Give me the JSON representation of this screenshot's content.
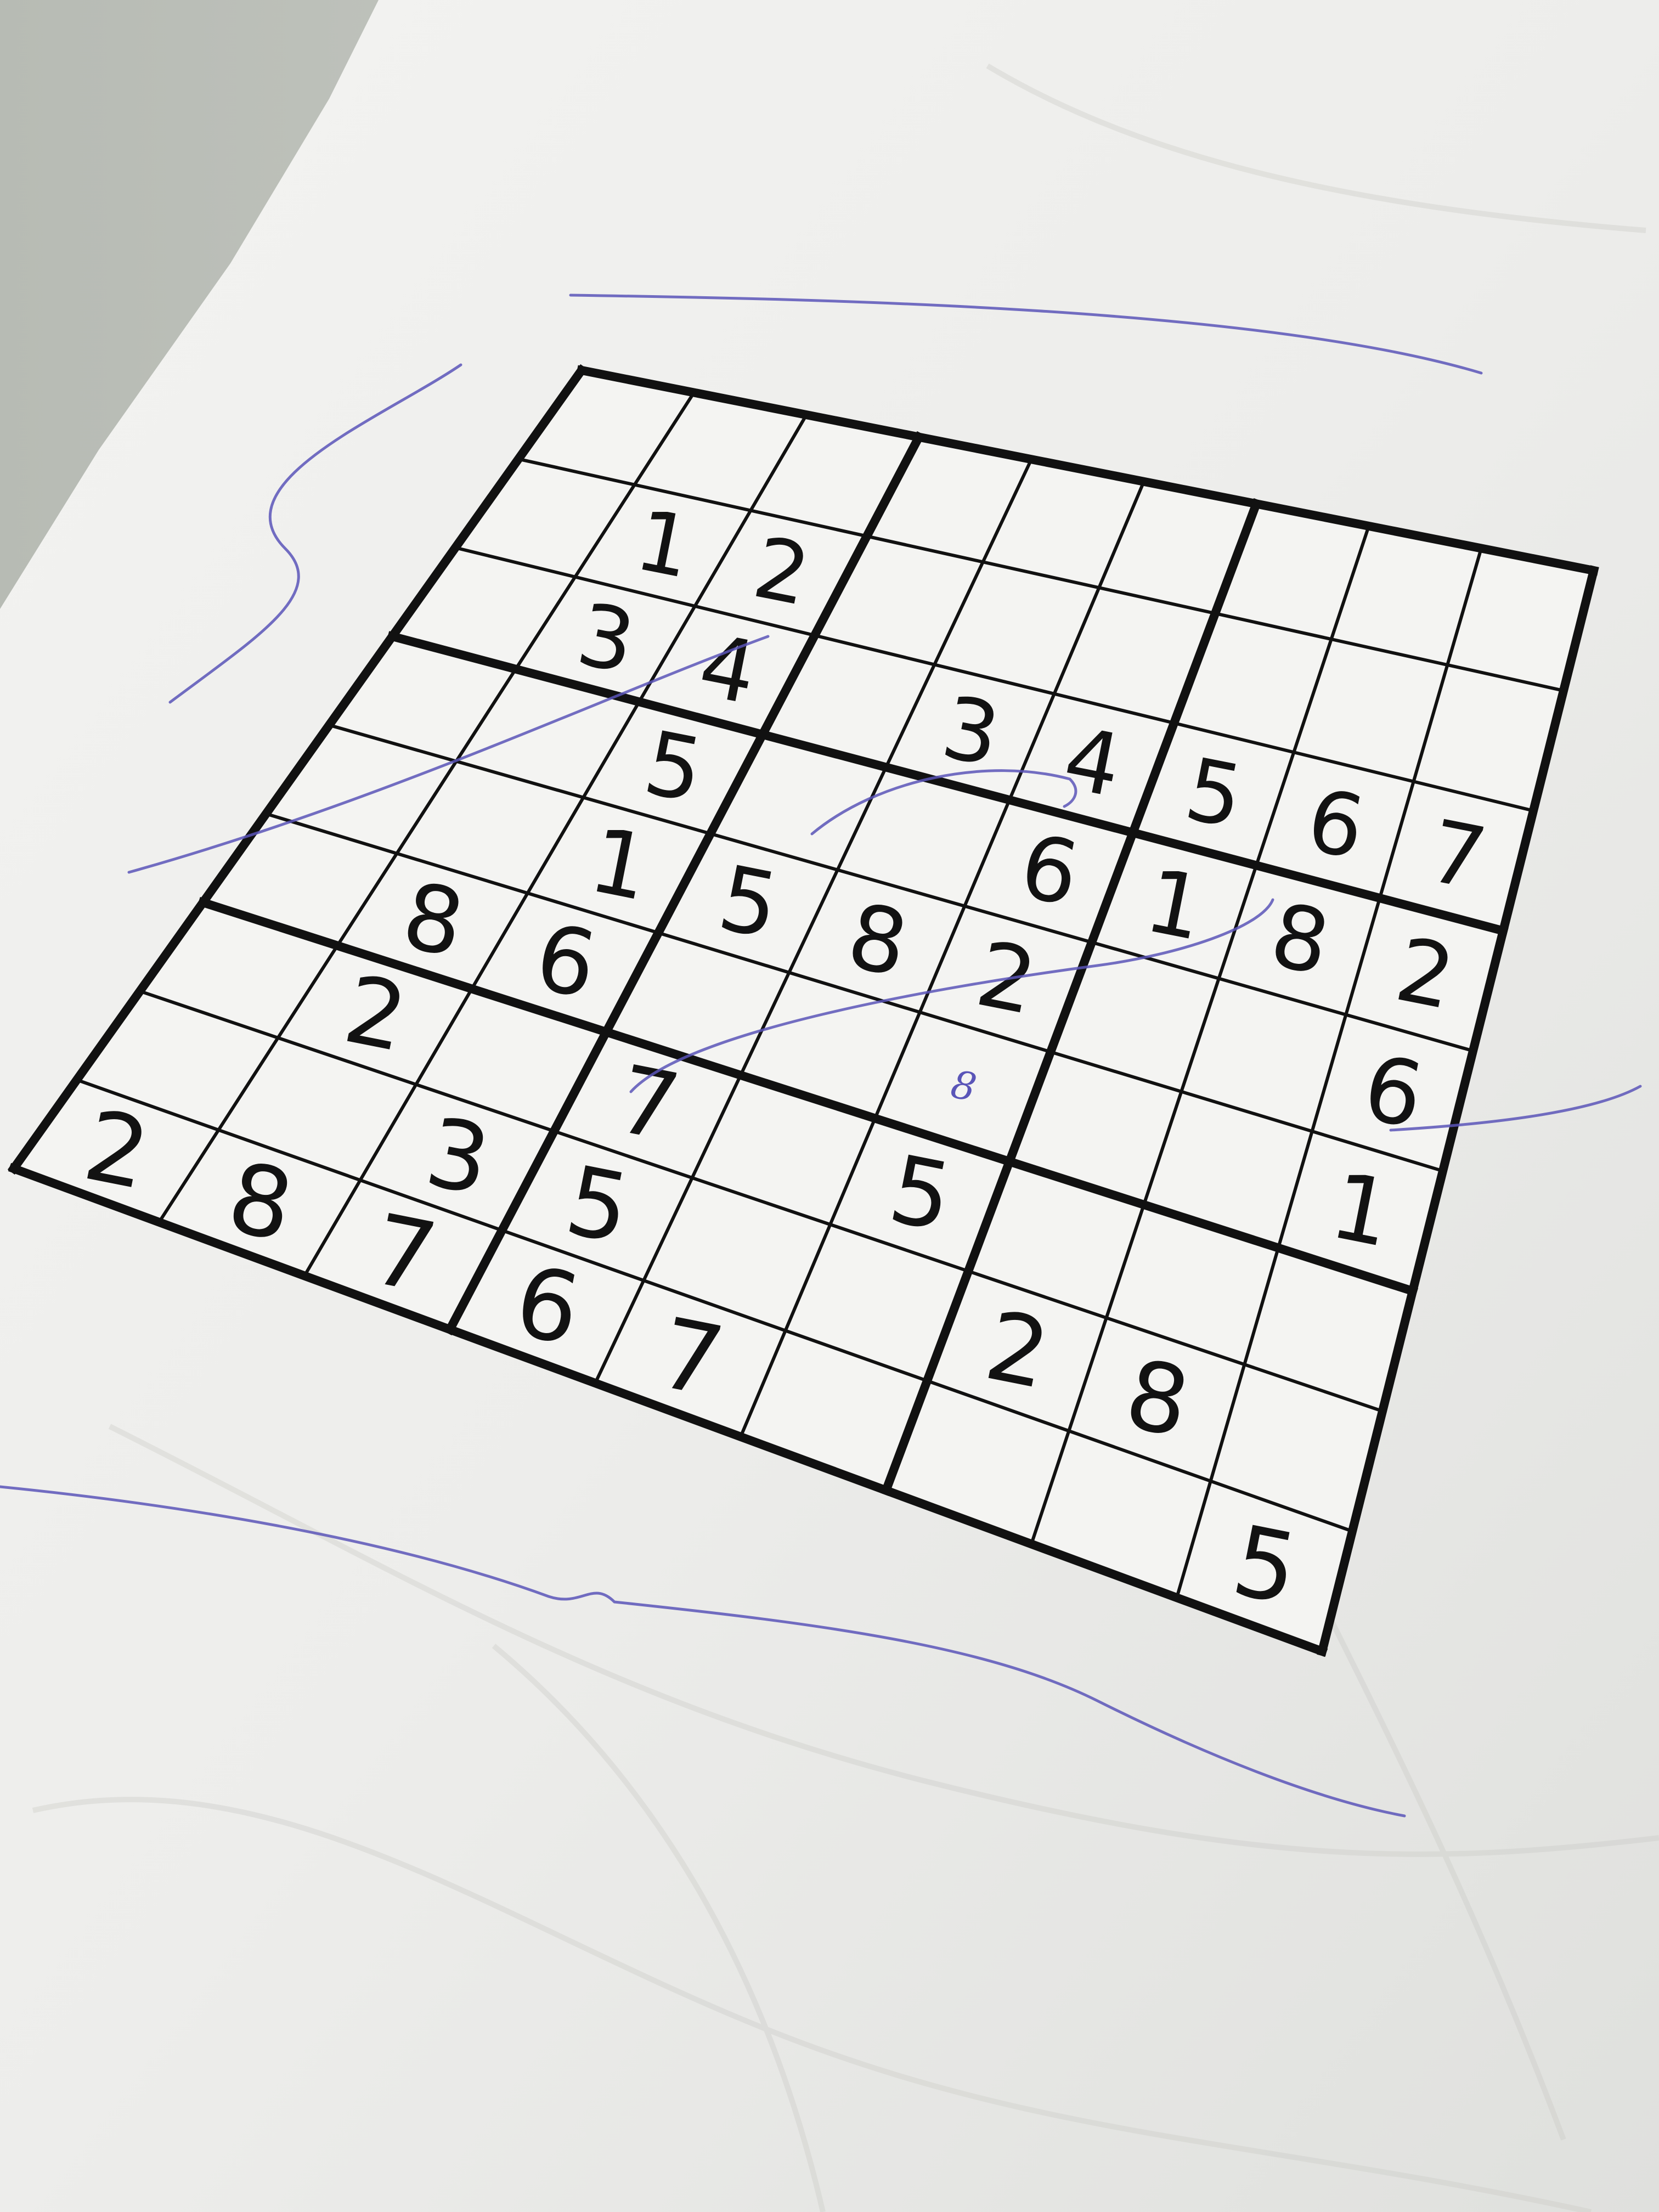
{
  "photo": {
    "subject": "printed sudoku puzzle on a crumpled sheet of paper",
    "colors": {
      "table": "#c6c9c3",
      "paper": "#f1f1ef",
      "paper_shade": "#dadad6",
      "grid_ink": "#111111",
      "pen_ink": "#5a55b8"
    }
  },
  "sudoku": {
    "size": 9,
    "printed_digits": [
      [
        0,
        0,
        0,
        0,
        0,
        0,
        0,
        0,
        0
      ],
      [
        0,
        1,
        2,
        0,
        0,
        0,
        0,
        0,
        0
      ],
      [
        0,
        3,
        4,
        0,
        3,
        4,
        5,
        6,
        7
      ],
      [
        0,
        0,
        5,
        0,
        0,
        6,
        1,
        8,
        2
      ],
      [
        0,
        0,
        1,
        5,
        8,
        2,
        0,
        0,
        6
      ],
      [
        0,
        8,
        6,
        0,
        0,
        0,
        0,
        0,
        1
      ],
      [
        0,
        2,
        0,
        7,
        0,
        5,
        0,
        0,
        0
      ],
      [
        0,
        0,
        3,
        5,
        0,
        0,
        2,
        8,
        0
      ],
      [
        2,
        8,
        7,
        6,
        7,
        0,
        0,
        0,
        5
      ]
    ],
    "handwritten_digits": [
      {
        "row": 5,
        "col": 5,
        "value": "8"
      }
    ]
  }
}
